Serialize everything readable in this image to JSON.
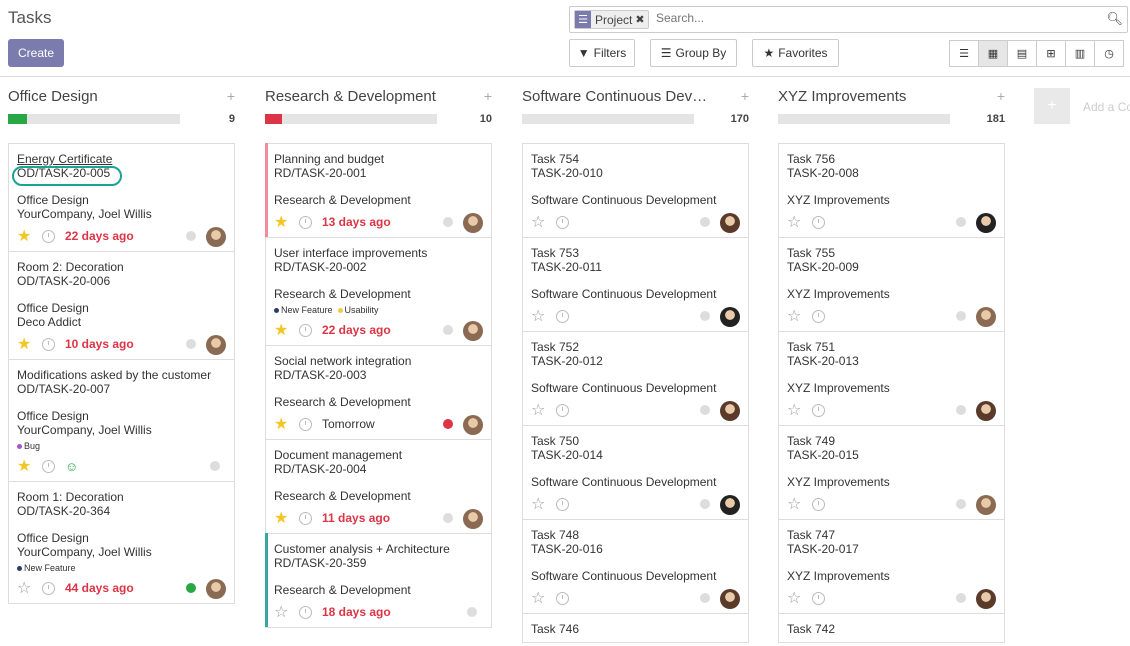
{
  "app": {
    "title": "Tasks",
    "create_label": "Create"
  },
  "search": {
    "facet_label": "Project",
    "placeholder": "Search..."
  },
  "toolbar": {
    "filters": "Filters",
    "group_by": "Group By",
    "favorites": "Favorites"
  },
  "view_switcher": [
    "list-icon",
    "kanban-icon",
    "calendar-icon",
    "pivot-icon",
    "graph-icon",
    "activity-icon"
  ],
  "add_column_label": "Add a Column",
  "colors": {
    "accent": "#7c7bad",
    "danger": "#dc3545",
    "success": "#28a745",
    "green_bar": "#28a745",
    "red_bar": "#dc3545"
  },
  "columns": [
    {
      "name": "Office Design",
      "count": "9",
      "progress": 0.11,
      "progress_color": "#28a745",
      "cards": [
        {
          "name": "Energy Certificate",
          "ref": "OD/TASK-20-005",
          "project": "Office Design",
          "customer": "YourCompany, Joel Willis",
          "tags": [],
          "starred": true,
          "deadline": "22 days ago",
          "deadline_late": true,
          "state": "#ddd",
          "avatar": "#8a6a52",
          "underline": true
        },
        {
          "name": "Room 2: Decoration",
          "ref": "OD/TASK-20-006",
          "project": "Office Design",
          "customer": "Deco Addict",
          "tags": [],
          "starred": true,
          "deadline": "10 days ago",
          "deadline_late": true,
          "state": "#ddd",
          "avatar": "#8a6a52"
        },
        {
          "name": "Modifications asked by the customer",
          "ref": "OD/TASK-20-007",
          "project": "Office Design",
          "customer": "YourCompany, Joel Willis",
          "tags": [
            {
              "label": "Bug",
              "color": "#a855c8"
            }
          ],
          "starred": true,
          "deadline": "",
          "smiley": "☺",
          "state": "#ddd",
          "avatar": ""
        },
        {
          "name": "Room 1: Decoration",
          "ref": "OD/TASK-20-364",
          "project": "Office Design",
          "customer": "YourCompany, Joel Willis",
          "tags": [
            {
              "label": "New Feature",
              "color": "#2c3e66"
            }
          ],
          "starred": false,
          "deadline": "44 days ago",
          "deadline_late": true,
          "state": "#28a745",
          "avatar": "#8a6a52"
        }
      ]
    },
    {
      "name": "Research & Development",
      "count": "10",
      "progress": 0.1,
      "progress_color": "#dc3545",
      "cards": [
        {
          "name": "Planning and budget",
          "ref": "RD/TASK-20-001",
          "project": "Research & Development",
          "customer": "",
          "tags": [],
          "starred": true,
          "deadline": "13 days ago",
          "deadline_late": true,
          "state": "#ddd",
          "avatar": "#8a6a52",
          "leftbar": "#f28b9b"
        },
        {
          "name": "User interface improvements",
          "ref": "RD/TASK-20-002",
          "project": "Research & Development",
          "customer": "",
          "tags": [
            {
              "label": "New Feature",
              "color": "#2c3e66"
            },
            {
              "label": "Usability",
              "color": "#f2c94c"
            }
          ],
          "starred": true,
          "deadline": "22 days ago",
          "deadline_late": true,
          "state": "#ddd",
          "avatar": "#8a6a52"
        },
        {
          "name": "Social network integration",
          "ref": "RD/TASK-20-003",
          "project": "Research & Development",
          "customer": "",
          "tags": [],
          "starred": true,
          "deadline": "Tomorrow",
          "deadline_late": false,
          "state": "#dc3545",
          "avatar": "#8a6a52"
        },
        {
          "name": "Document management",
          "ref": "RD/TASK-20-004",
          "project": "Research & Development",
          "customer": "",
          "tags": [],
          "starred": true,
          "deadline": "11 days ago",
          "deadline_late": true,
          "state": "#ddd",
          "avatar": "#8a6a52"
        },
        {
          "name": "Customer analysis + Architecture",
          "ref": "RD/TASK-20-359",
          "project": "Research & Development",
          "customer": "",
          "tags": [],
          "starred": false,
          "deadline": "18 days ago",
          "deadline_late": true,
          "state": "#ddd",
          "avatar": "",
          "leftbar": "#3aa6a0"
        }
      ]
    },
    {
      "name": "Software Continuous Dev…",
      "count": "170",
      "progress": 0,
      "progress_color": "#e4e4e4",
      "cards": [
        {
          "name": "Task 754",
          "ref": "TASK-20-010",
          "project": "Software Continuous Development",
          "customer": "",
          "tags": [],
          "starred": false,
          "deadline": "",
          "state": "#ddd",
          "avatar": "#5a3a2a"
        },
        {
          "name": "Task 753",
          "ref": "TASK-20-011",
          "project": "Software Continuous Development",
          "customer": "",
          "tags": [],
          "starred": false,
          "deadline": "",
          "state": "#ddd",
          "avatar": "#222"
        },
        {
          "name": "Task 752",
          "ref": "TASK-20-012",
          "project": "Software Continuous Development",
          "customer": "",
          "tags": [],
          "starred": false,
          "deadline": "",
          "state": "#ddd",
          "avatar": "#5a3a2a"
        },
        {
          "name": "Task 750",
          "ref": "TASK-20-014",
          "project": "Software Continuous Development",
          "customer": "",
          "tags": [],
          "starred": false,
          "deadline": "",
          "state": "#ddd",
          "avatar": "#222"
        },
        {
          "name": "Task 748",
          "ref": "TASK-20-016",
          "project": "Software Continuous Development",
          "customer": "",
          "tags": [],
          "starred": false,
          "deadline": "",
          "state": "#ddd",
          "avatar": "#5a3a2a"
        },
        {
          "name": "Task 746",
          "ref": "",
          "project": "",
          "customer": "",
          "tags": [],
          "starred": false,
          "deadline": "",
          "state": "",
          "avatar": ""
        }
      ]
    },
    {
      "name": "XYZ Improvements",
      "count": "181",
      "progress": 0,
      "progress_color": "#e4e4e4",
      "cards": [
        {
          "name": "Task 756",
          "ref": "TASK-20-008",
          "project": "XYZ Improvements",
          "customer": "",
          "tags": [],
          "starred": false,
          "deadline": "",
          "state": "#ddd",
          "avatar": "#222"
        },
        {
          "name": "Task 755",
          "ref": "TASK-20-009",
          "project": "XYZ Improvements",
          "customer": "",
          "tags": [],
          "starred": false,
          "deadline": "",
          "state": "#ddd",
          "avatar": "#8a6a52"
        },
        {
          "name": "Task 751",
          "ref": "TASK-20-013",
          "project": "XYZ Improvements",
          "customer": "",
          "tags": [],
          "starred": false,
          "deadline": "",
          "state": "#ddd",
          "avatar": "#5a3a2a"
        },
        {
          "name": "Task 749",
          "ref": "TASK-20-015",
          "project": "XYZ Improvements",
          "customer": "",
          "tags": [],
          "starred": false,
          "deadline": "",
          "state": "#ddd",
          "avatar": "#8a6a52"
        },
        {
          "name": "Task 747",
          "ref": "TASK-20-017",
          "project": "XYZ Improvements",
          "customer": "",
          "tags": [],
          "starred": false,
          "deadline": "",
          "state": "#ddd",
          "avatar": "#5a3a2a"
        },
        {
          "name": "Task 742",
          "ref": "",
          "project": "",
          "customer": "",
          "tags": [],
          "starred": false,
          "deadline": "",
          "state": "",
          "avatar": ""
        }
      ]
    }
  ]
}
